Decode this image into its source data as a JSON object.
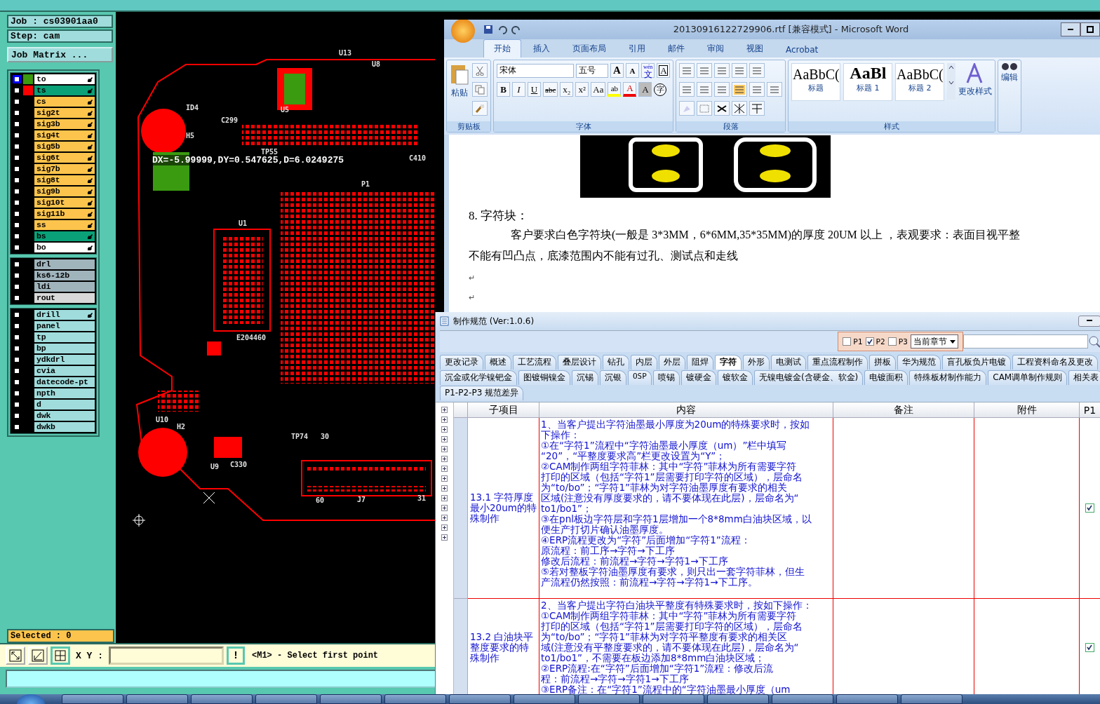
{
  "cam": {
    "job": "Job : cs03901aa0",
    "step": "Step: cam",
    "matrix_button": "Job Matrix ...",
    "layer_groups": [
      [
        {
          "name": "to",
          "color": "#ffffff",
          "selected": true,
          "swatch": {
            "color": "#3a9a10"
          },
          "hand": true
        },
        {
          "name": "ts",
          "color": "#0aa078",
          "selected": false,
          "swatch": {
            "color": "#ff0000"
          },
          "hand": true
        },
        {
          "name": "cs",
          "color": "#fcc44c",
          "selected": false,
          "hand": true
        },
        {
          "name": "sig2t",
          "color": "#fcc44c",
          "selected": false,
          "hand": true
        },
        {
          "name": "sig3b",
          "color": "#fcc44c",
          "selected": false,
          "hand": true
        },
        {
          "name": "sig4t",
          "color": "#fcc44c",
          "selected": false,
          "hand": true
        },
        {
          "name": "sig5b",
          "color": "#fcc44c",
          "selected": false,
          "hand": true
        },
        {
          "name": "sig6t",
          "color": "#fcc44c",
          "selected": false,
          "hand": true
        },
        {
          "name": "sig7b",
          "color": "#fcc44c",
          "selected": false,
          "hand": true
        },
        {
          "name": "sig8t",
          "color": "#fcc44c",
          "selected": false,
          "hand": true
        },
        {
          "name": "sig9b",
          "color": "#fcc44c",
          "selected": false,
          "hand": true
        },
        {
          "name": "sig10t",
          "color": "#fcc44c",
          "selected": false,
          "hand": true
        },
        {
          "name": "sig11b",
          "color": "#fcc44c",
          "selected": false,
          "hand": true
        },
        {
          "name": "ss",
          "color": "#fcc44c",
          "selected": false,
          "hand": true
        },
        {
          "name": "bs",
          "color": "#0aa078",
          "selected": false,
          "hand": true
        },
        {
          "name": "bo",
          "color": "#ffffff",
          "selected": false,
          "hand": true
        }
      ],
      [
        {
          "name": "drl",
          "color": "#a0b4bc",
          "selected": false,
          "hand": false
        },
        {
          "name": "ks6-12b",
          "color": "#a0b4bc",
          "selected": false,
          "hand": false
        },
        {
          "name": "ldi",
          "color": "#a0b4bc",
          "selected": false,
          "hand": false
        },
        {
          "name": "rout",
          "color": "#d8d8d8",
          "selected": false,
          "hand": false
        }
      ],
      [
        {
          "name": "drill",
          "color": "#a0dcdc",
          "selected": false,
          "hand": true
        },
        {
          "name": "panel",
          "color": "#a0dcdc",
          "selected": false,
          "hand": false
        },
        {
          "name": "tp",
          "color": "#a0dcdc",
          "selected": false,
          "hand": false
        },
        {
          "name": "bp",
          "color": "#a0dcdc",
          "selected": false,
          "hand": false
        },
        {
          "name": "ydkdrl",
          "color": "#a0dcdc",
          "selected": false,
          "hand": false
        },
        {
          "name": "cvia",
          "color": "#a0dcdc",
          "selected": false,
          "hand": false
        },
        {
          "name": "datecode-pt",
          "color": "#a0dcdc",
          "selected": false,
          "hand": false
        },
        {
          "name": "npth",
          "color": "#a0dcdc",
          "selected": false,
          "hand": false
        },
        {
          "name": "d",
          "color": "#a0dcdc",
          "selected": false,
          "hand": false
        },
        {
          "name": "dwk",
          "color": "#a0dcdc",
          "selected": false,
          "hand": false
        },
        {
          "name": "dwkb",
          "color": "#a0dcdc",
          "selected": false,
          "hand": false
        }
      ]
    ],
    "selected_count": "Selected : 0",
    "xy_label": "X Y :",
    "alert_button": "!",
    "prompt": "<M1> - Select first point",
    "measurement": "DX=-5.99999,DY=0.547625,D=6.0249275",
    "board_labels": [
      "ID4",
      "H5",
      "C299",
      "U13",
      "U8",
      "U5",
      "U1",
      "P1",
      "C410",
      "TP55",
      "U10",
      "H2",
      "C330",
      "U9",
      "J7",
      "TP74",
      "30",
      "60",
      "31",
      "E204460"
    ]
  },
  "word": {
    "title": "20130916122729906.rtf [兼容模式] - Microsoft Word",
    "tabs": [
      {
        "label": "开始",
        "selected": true
      },
      {
        "label": "插入",
        "selected": false
      },
      {
        "label": "页面布局",
        "selected": false
      },
      {
        "label": "引用",
        "selected": false
      },
      {
        "label": "邮件",
        "selected": false
      },
      {
        "label": "审阅",
        "selected": false
      },
      {
        "label": "视图",
        "selected": false
      },
      {
        "label": "Acrobat",
        "selected": false
      }
    ],
    "paste": "粘贴",
    "font_name": "宋体",
    "font_size": "五号",
    "font_tools": [
      {
        "kind": "grow",
        "label": "A"
      },
      {
        "kind": "shrink",
        "label": "A"
      },
      {
        "kind": "phonetic",
        "label": "文",
        "top": "wén"
      },
      {
        "kind": "border",
        "label": "A"
      }
    ],
    "format_buttons": [
      {
        "kind": "bold",
        "label": "B"
      },
      {
        "kind": "italic",
        "label": "I"
      },
      {
        "kind": "underline",
        "label": "U"
      },
      {
        "kind": "strike",
        "label": "abc"
      },
      {
        "kind": "sub",
        "label": "x₂"
      },
      {
        "kind": "sup",
        "label": "x²"
      },
      {
        "kind": "case",
        "label": "Aa"
      },
      {
        "kind": "highlight",
        "label": "ab"
      },
      {
        "kind": "color",
        "label": "A"
      },
      {
        "kind": "shading",
        "label": "A"
      },
      {
        "kind": "enclose",
        "label": "字"
      }
    ],
    "styles": [
      {
        "preview": "AaBbC(",
        "name": "标题"
      },
      {
        "preview": "AaBl",
        "name": "标题 1"
      },
      {
        "preview": "AaBbC(",
        "name": "标题 2"
      }
    ],
    "change_styles": "更改样式",
    "edit": "编辑",
    "groups": [
      "剪贴板",
      "字体",
      "段落",
      "样式"
    ],
    "doc": {
      "heading": "8. 字符块：",
      "lines": [
        "客户要求白色字符块(一般是 3*3MM，6*6MM,35*35MM)的厚度 20UM 以上 ，表观要求：表面目视平整",
        "不能有凹凸点，底漆范围内不能有过孔、测试点和走线"
      ],
      "empty_paragraphs": [
        "↵",
        "↵"
      ]
    }
  },
  "spec": {
    "title": "制作规范 (Ver:1.0.6)",
    "filters": [
      {
        "label": "P1",
        "checked": false
      },
      {
        "label": "P2",
        "checked": true
      },
      {
        "label": "P3",
        "checked": false
      }
    ],
    "scope": "当前章节",
    "tab_rows": [
      [
        {
          "label": "更改记录",
          "selected": false
        },
        {
          "label": "概述",
          "selected": false
        },
        {
          "label": "工艺流程",
          "selected": false
        },
        {
          "label": "叠层设计",
          "selected": false
        },
        {
          "label": "钻孔",
          "selected": false
        },
        {
          "label": "内层",
          "selected": false
        },
        {
          "label": "外层",
          "selected": false
        },
        {
          "label": "阻焊",
          "selected": false
        },
        {
          "label": "字符",
          "selected": true
        },
        {
          "label": "外形",
          "selected": false
        },
        {
          "label": "电测试",
          "selected": false
        },
        {
          "label": "重点流程制作",
          "selected": false
        },
        {
          "label": "拼板",
          "selected": false
        },
        {
          "label": "华为规范",
          "selected": false
        },
        {
          "label": "盲孔板负片电镀",
          "selected": false
        },
        {
          "label": "工程资料命名及更改",
          "selected": false
        }
      ],
      [
        {
          "label": "沉金或化学镍钯金",
          "selected": false
        },
        {
          "label": "图镀铜镍金",
          "selected": false
        },
        {
          "label": "沉锡",
          "selected": false
        },
        {
          "label": "沉银",
          "selected": false
        },
        {
          "label": "OSP",
          "selected": false
        },
        {
          "label": "喷锡",
          "selected": false
        },
        {
          "label": "镀硬金",
          "selected": false
        },
        {
          "label": "镀软金",
          "selected": false
        },
        {
          "label": "无镍电镀金(含硬金、软金)",
          "selected": false
        },
        {
          "label": "电镀面积",
          "selected": false
        },
        {
          "label": "特殊板材制作能力",
          "selected": false
        },
        {
          "label": "CAM调单制作规则",
          "selected": false
        },
        {
          "label": "相关表",
          "selected": false
        }
      ],
      [
        {
          "label": "P1-P2-P3 规范差异",
          "selected": false
        }
      ]
    ],
    "columns": [
      "子项目",
      "内容",
      "备注",
      "附件",
      "P1"
    ],
    "rows": [
      {
        "item": "13.1 字符厚度最小20um的特殊制作",
        "p1": true,
        "content": [
          "1、当客户提出字符油墨最小厚度为20um的特殊要求时，按如",
          "下操作：",
          "①在“字符1”流程中“字符油墨最小厚度（um）”栏中填写",
          "“20”，“平整度要求高”栏更改设置为“Y”；",
          "②CAM制作两组字符菲林：其中“字符”菲林为所有需要字符",
          "打印的区域（包括“字符1”层需要打印字符的区域），层命名",
          "为“to/bo”；“字符1”菲林为对字符油墨厚度有要求的相关",
          "区域(注意没有厚度要求的，请不要体现在此层)，层命名为“",
          "to1/bo1”；",
          "③在pnl板边字符层和字符1层增加一个8*8mm白油块区域，以",
          "便生产打切片确认油墨厚度。",
          "④ERP流程更改为“字符”后面增加“字符1”流程：",
          "原流程：前工序→字符→下工序",
          "修改后流程：前流程→字符→字符1→下工序",
          "⑤若对整板字符油墨厚度有要求，则只出一套字符菲林，但生",
          "产流程仍然按照：前流程→字符→字符1→下工序。"
        ]
      },
      {
        "item": "13.2 白油块平整度要求的特殊制作",
        "p1": true,
        "content": [
          "2、当客户提出字符白油块平整度有特殊要求时，按如下操作：",
          "①CAM制作两组字符菲林：其中“字符”菲林为所有需要字符",
          "打印的区域（包括“字符1”层需要打印字符的区域），层命名",
          "为“to/bo”；“字符1”菲林为对字符平整度有要求的相关区",
          "域(注意没有平整度要求的，请不要体现在此层)，层命名为“",
          "to1/bo1”，不需要在板边添加8*8mm白油块区域；",
          "②ERP流程:在“字符”后面增加“字符1”流程：修改后流",
          "程：前流程→字符→字符1→下工序",
          "③ERP备注：在“字符1”流程中的“字符油墨最小厚度（um"
        ]
      }
    ]
  }
}
